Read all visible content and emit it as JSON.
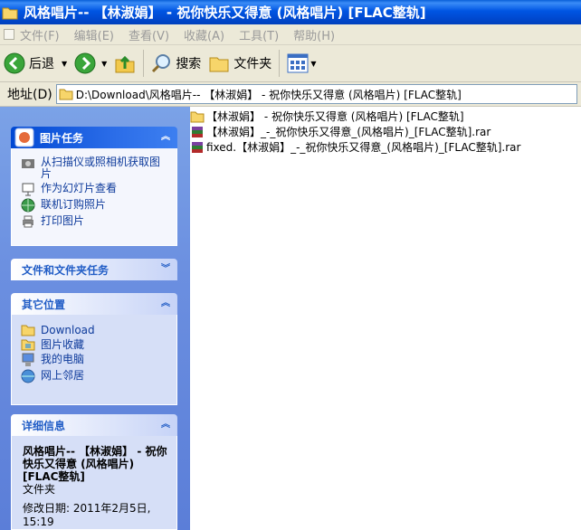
{
  "window": {
    "title": "风格唱片-- 【林淑娟】 - 祝你快乐又得意 (风格唱片) [FLAC整轨]"
  },
  "menu": [
    "文件(F)",
    "编辑(E)",
    "查看(V)",
    "收藏(A)",
    "工具(T)",
    "帮助(H)"
  ],
  "toolbar": {
    "back": "后退",
    "search": "搜索",
    "folders": "文件夹"
  },
  "address": {
    "label": "地址(D)",
    "path": "D:\\Download\\风格唱片-- 【林淑娟】 - 祝你快乐又得意 (风格唱片) [FLAC整轨]"
  },
  "tasks": {
    "picture": {
      "title": "图片任务",
      "items": [
        "从扫描仪或照相机获取图片",
        "作为幻灯片查看",
        "联机订购照片",
        "打印图片"
      ]
    },
    "file": {
      "title": "文件和文件夹任务"
    },
    "places": {
      "title": "其它位置",
      "items": [
        "Download",
        "图片收藏",
        "我的电脑",
        "网上邻居"
      ]
    },
    "details": {
      "title": "详细信息",
      "name": "风格唱片-- 【林淑娟】 - 祝你快乐又得意 (风格唱片) [FLAC整轨]",
      "type": "文件夹",
      "modified": "修改日期: 2011年2月5日, 15:19"
    }
  },
  "files": [
    {
      "name": "【林淑娟】 - 祝你快乐又得意 (风格唱片) [FLAC整轨]",
      "icon": "folder-icon"
    },
    {
      "name": "【林淑娟】_-_祝你快乐又得意_(风格唱片)_[FLAC整轨].rar",
      "icon": "rar-icon"
    },
    {
      "name": "fixed.【林淑娟】_-_祝你快乐又得意_(风格唱片)_[FLAC整轨].rar",
      "icon": "rar-icon"
    }
  ]
}
